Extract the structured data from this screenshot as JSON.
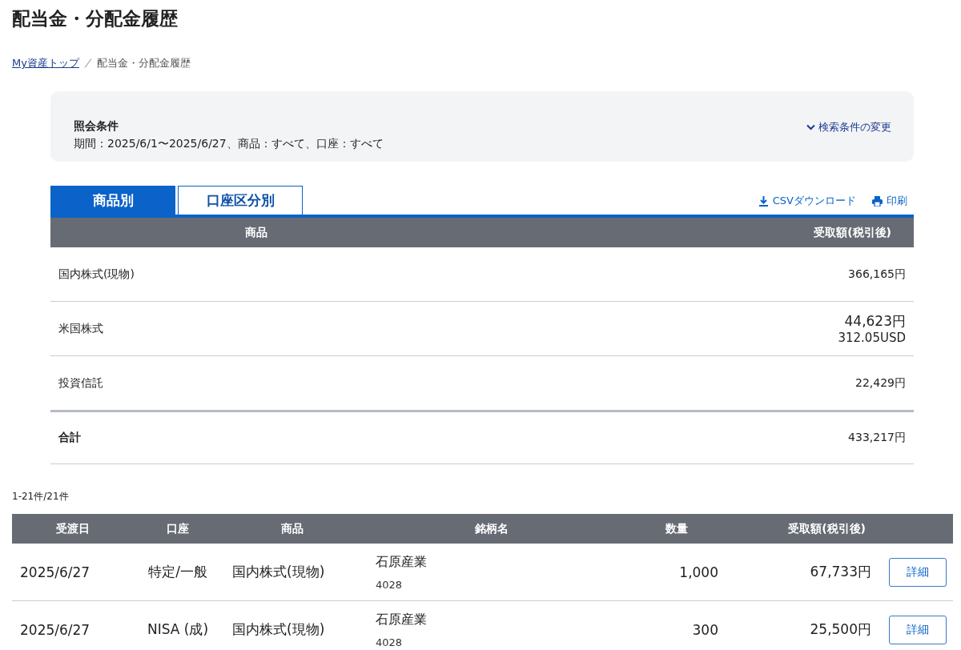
{
  "page_title": "配当金・分配金履歴",
  "breadcrumb": [
    {
      "label": "My資産トップ",
      "kind": "link"
    },
    {
      "label": "配当金・分配金履歴",
      "kind": "current"
    }
  ],
  "conditions": {
    "title": "照会条件",
    "text": "期間：2025/6/1〜2025/6/27、商品：すべて、口座：すべて",
    "change_link": "検索条件の変更"
  },
  "tabs": [
    {
      "label": "商品別",
      "selected": true
    },
    {
      "label": "口座区分別",
      "selected": false
    }
  ],
  "actions": [
    {
      "label": "CSVダウンロード",
      "kind": "download"
    },
    {
      "label": "印刷",
      "kind": "print"
    }
  ],
  "summary": {
    "columns": [
      "商品",
      "受取額(税引後)"
    ],
    "rows": [
      {
        "product": "国内株式(現物)",
        "amount": "366,165円",
        "kind": "item"
      },
      {
        "product": "米国株式",
        "amount": "44,623円",
        "sub_amount": "312.05USD",
        "kind": "item"
      },
      {
        "product": "投資信託",
        "amount": "22,429円",
        "kind": "item"
      },
      {
        "product": "合計",
        "amount": "433,217円",
        "kind": "total"
      }
    ]
  },
  "count": "1-21件/21件",
  "details": {
    "columns": [
      "受渡日",
      "口座",
      "商品",
      "銘柄名",
      "数量",
      "受取額(税引後)"
    ],
    "rows": [
      {
        "date": "2025/6/27",
        "account": "特定/一般",
        "product": "国内株式(現物)",
        "name": "石原産業",
        "code": "4028",
        "quantity": "1,000",
        "amount": "67,733円",
        "button": "詳細"
      },
      {
        "date": "2025/6/27",
        "account": "NISA (成)",
        "product": "国内株式(現物)",
        "name": "石原産業",
        "code": "4028",
        "quantity": "300",
        "amount": "25,500円",
        "button": "詳細"
      }
    ]
  }
}
